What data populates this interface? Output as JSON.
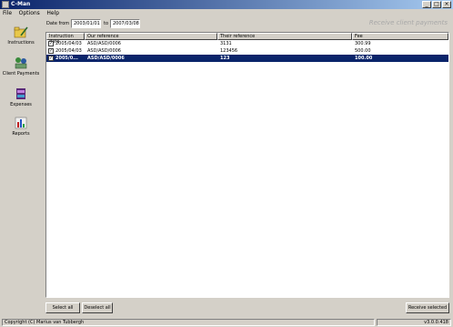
{
  "window": {
    "title": "C-Man",
    "controls": {
      "minimize": "_",
      "maximize": "□",
      "close": "×"
    }
  },
  "menu": [
    "File",
    "Options",
    "Help"
  ],
  "nav": [
    {
      "label": "Instructions",
      "icon": "folder-pencil-icon"
    },
    {
      "label": "Client Payments",
      "icon": "people-payments-icon"
    },
    {
      "label": "Expenses",
      "icon": "expenses-icon"
    },
    {
      "label": "Reports",
      "icon": "reports-chart-icon"
    }
  ],
  "date_filter": {
    "from_label": "Date from",
    "from_value": "2003/01/01",
    "to_label": "to",
    "to_value": "2007/03/08"
  },
  "receive_header": "Receive client payments",
  "table": {
    "columns": [
      "Instruction date",
      "Our reference",
      "Their reference",
      "Fee"
    ],
    "rows": [
      {
        "checked": true,
        "date": "2005/04/03",
        "our_ref": "ASD/ASD/0006",
        "their_ref": "3131",
        "fee": "300.99",
        "selected": false
      },
      {
        "checked": true,
        "date": "2005/04/03",
        "our_ref": "ASD/ASD/0006",
        "their_ref": "123456",
        "fee": "500.00",
        "selected": false
      },
      {
        "checked": true,
        "date": "2005/0...",
        "our_ref": "ASD/ASD/0006",
        "their_ref": "123",
        "fee": "100.00",
        "selected": true
      }
    ]
  },
  "buttons": {
    "select_all": "Select all",
    "deselect_all": "Deselect all",
    "receive_selected": "Receive selected"
  },
  "status": {
    "copyright": "Copyright (C) Marius van Tubbergh",
    "version": "v3.0.0.418"
  },
  "colors": {
    "titlebar": "#0a246a",
    "selection": "#0a246a",
    "window_bg": "#d4d0c8"
  }
}
